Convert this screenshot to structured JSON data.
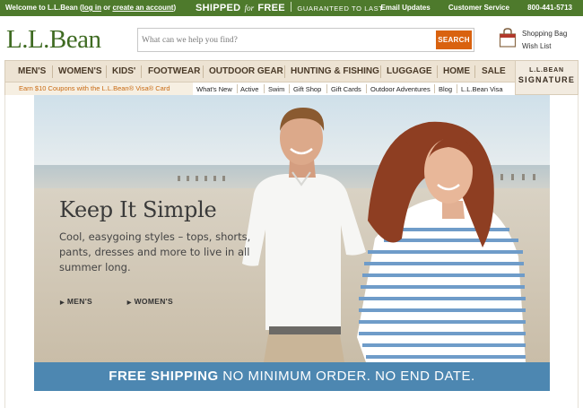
{
  "topbar": {
    "welcome_prefix": "Welcome to L.L.Bean (",
    "login": "log in",
    "or": "or",
    "create_account": "create an account",
    "welcome_suffix": ")",
    "promo_shipped": "SHIPPED",
    "promo_for": "for",
    "promo_free": "FREE",
    "promo_guarantee": "GUARANTEED TO LAST",
    "email_updates": "Email Updates",
    "customer_service": "Customer Service",
    "phone": "800-441-5713",
    "bg_color": "#4e7a2c"
  },
  "header": {
    "logo": "L.L.Bean",
    "search_placeholder": "What can we help you find?",
    "search_button": "SEARCH",
    "shopping_bag": "Shopping Bag",
    "wish_list": "Wish List"
  },
  "nav": {
    "items": [
      "MEN'S",
      "WOMEN'S",
      "KIDS'",
      "FOOTWEAR",
      "OUTDOOR GEAR",
      "HUNTING & FISHING",
      "LUGGAGE",
      "HOME",
      "SALE"
    ],
    "signature_top": "L.L.BEAN",
    "signature_bottom": "SIGNATURE"
  },
  "subnav": {
    "coupon": "Earn $10 Coupons with the L.L.Bean® Visa® Card",
    "links": [
      "What's New",
      "Active",
      "Swim",
      "Gift Shop",
      "Gift Cards",
      "Outdoor Adventures",
      "Blog",
      "L.L.Bean Visa"
    ]
  },
  "hero": {
    "headline": "Keep It Simple",
    "body": "Cool, easygoing styles – tops, shorts, pants, dresses and more to live in all summer long.",
    "link_mens": "MEN'S",
    "link_womens": "WOMEN'S"
  },
  "shipping": {
    "bold": "FREE SHIPPING",
    "rest": " NO MINIMUM ORDER. NO END DATE.",
    "bg_color": "#4d87b1"
  }
}
